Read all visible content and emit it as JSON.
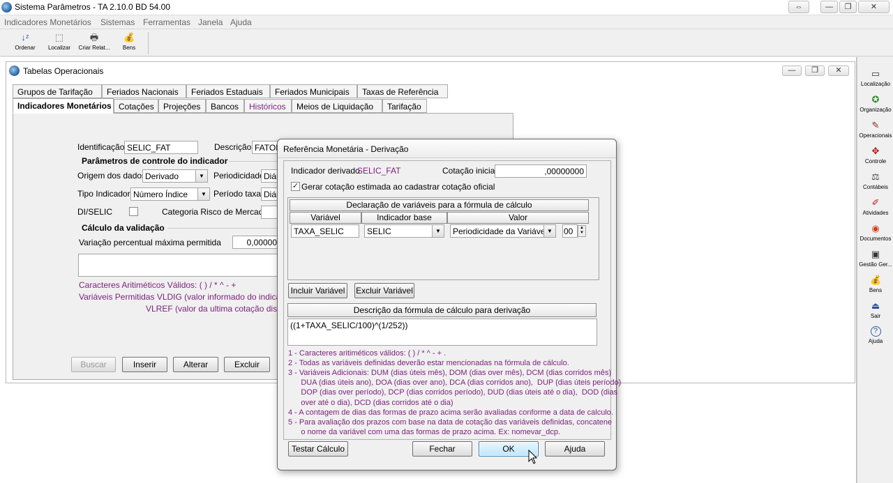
{
  "app": {
    "title": "Sistema Parâmetros -  TA 2.10.0 BD 54.00",
    "restore_glyph": "⇔",
    "min_glyph": "—",
    "max_glyph": "❐",
    "close_glyph": "✕"
  },
  "menu": [
    "Indicadores Monetários",
    "Sistemas",
    "Ferramentas",
    "Janela",
    "Ajuda"
  ],
  "toolbar": [
    {
      "label": "Ordenar",
      "icon": "sort-az-icon",
      "glyph": "↓ᶻ"
    },
    {
      "label": "Localizar",
      "icon": "find-icon",
      "glyph": "⬚"
    },
    {
      "label": "Criar Relat...",
      "icon": "printer-icon",
      "glyph": "🖶"
    },
    {
      "label": "Bens",
      "icon": "money-bag-icon",
      "glyph": "💰"
    }
  ],
  "rightbar": [
    {
      "label": "Localização",
      "icon": "location-icon",
      "glyph": "▭"
    },
    {
      "label": "Organização",
      "icon": "organization-icon",
      "glyph": "✪"
    },
    {
      "label": "Operacionais",
      "icon": "operational-icon",
      "glyph": "✎"
    },
    {
      "label": "Controle",
      "icon": "control-icon",
      "glyph": "✥"
    },
    {
      "label": "Contábeis",
      "icon": "scales-icon",
      "glyph": "⚖"
    },
    {
      "label": "Atividades",
      "icon": "activities-icon",
      "glyph": "✐"
    },
    {
      "label": "Documentos",
      "icon": "documents-icon",
      "glyph": "◉"
    },
    {
      "label": "Gestão Ger...",
      "icon": "management-icon",
      "glyph": "▣"
    },
    {
      "label": "Bens",
      "icon": "money-bag-icon",
      "glyph": "💰"
    },
    {
      "label": "Sair",
      "icon": "exit-icon",
      "glyph": "⏏"
    },
    {
      "label": "Ajuda",
      "icon": "help-icon",
      "glyph": "?"
    }
  ],
  "mdi": {
    "title": "Tabelas Operacionais",
    "tabs_row1": [
      "Grupos de Tarifação",
      "Feriados Nacionais",
      "Feriados Estaduais",
      "Feriados Municipais",
      "Taxas de Referência"
    ],
    "tabs_row2": [
      "Indicadores Monetários",
      "Cotações",
      "Projeções",
      "Bancos",
      "Históricos",
      "Meios de Liquidação",
      "Tarifação"
    ],
    "form": {
      "identificacao_label": "Identificação",
      "identificacao_value": "SELIC_FAT",
      "descricao_label": "Descrição",
      "descricao_value": "FATOR",
      "params_title": "Parâmetros de controle do indicador",
      "origem_label": "Origem dos dados",
      "origem_value": "Derivado",
      "periodicidade_label": "Periodicidade",
      "periodicidade_value": "Diár",
      "tipo_label": "Tipo Indicador",
      "tipo_value": "Número Índice",
      "periodo_taxa_label": "Período taxa",
      "periodo_taxa_value": "Diár",
      "diselic_label": "DI/SELIC",
      "categoria_label": "Categoria Risco de Mercado",
      "calculo_title": "Cálculo da validação",
      "variacao_label": "Variação percentual máxima permitida",
      "variacao_value": "0,00000",
      "caracteres_text": "Caracteres Aritiméticos Válidos:     ( ) / * ^ - +",
      "variaveis_text": "Variáveis Permitidas VLDIG  (valor informado do indicador)",
      "vlref_text": "VLREF (valor da ultima cotação disponí"
    },
    "buttons": {
      "buscar": "Buscar",
      "inserir": "Inserir",
      "alterar": "Alterar",
      "excluir": "Excluir"
    }
  },
  "dialog": {
    "title": "Referência Monetária - Derivação",
    "indicador_label": "Indicador derivado",
    "indicador_value": "SELIC_FAT",
    "cotacao_label": "Cotação inicial",
    "cotacao_value": ",00000000",
    "gerar_label": "Gerar cotação estimada ao cadastrar cotação oficial",
    "gerar_checked": true,
    "vars_header": "Declaração de variáveis para a fórmula de cálculo",
    "col_variavel": "Variável",
    "col_indicador": "Indicador base",
    "col_valor": "Valor",
    "row": {
      "variavel": "TAXA_SELIC",
      "indicador": "SELIC",
      "valor": "Periodicidade da Variável",
      "num": "00"
    },
    "incluir_button": "Incluir Variável",
    "excluir_button": "Excluir Variável",
    "formula_header": "Descrição da fórmula de cálculo para derivação",
    "formula": "((1+TAXA_SELIC/100)^(1/252))",
    "notes": [
      "1 - Caracteres aritiméticos válidos: ( ) / * ^ - + .",
      "2 - Todas as variáveis definidas deverão estar mencionadas na fórmula de cálculo.",
      "3 - Variáveis Adicionais: DUM (dias úteis mês), DOM (dias over mês), DCM (dias corridos mês)",
      "      DUA (dias úteis ano), DOA (dias over ano), DCA (dias corridos ano),  DUP (dias úteis período)",
      "      DOP (dias over período), DCP (dias corridos período), DUD (dias úteis até o dia),  DOD (dias",
      "      over até o dia), DCD (dias corridos até o dia)",
      "4 - A contagem de dias das formas de prazo acima serão avaliadas conforme a data de calculo.",
      "5 - Para avaliação dos prazos com base na data de cotação das variáveis definidas, concatene",
      "      o nome da variável com uma das formas de prazo acima. Ex: nomevar_dcp."
    ],
    "testar_button": "Testar Cálculo",
    "fechar_button": "Fechar",
    "ok_button": "OK",
    "ajuda_button": "Ajuda"
  },
  "colors": {
    "accent_purple": "#7a1f7a",
    "window_bg": "#f0f0f0"
  }
}
